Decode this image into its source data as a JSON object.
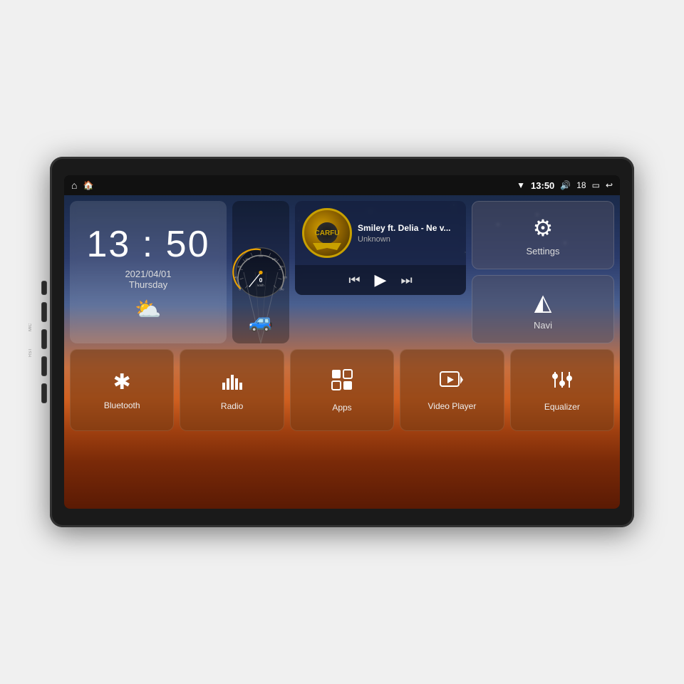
{
  "device": {
    "mic_label": "MIC",
    "rst_label": "RST"
  },
  "status_bar": {
    "time": "13:50",
    "volume": "18",
    "wifi_icon": "wifi",
    "battery_icon": "battery",
    "back_icon": "back"
  },
  "clock": {
    "time": "13 : 50",
    "date": "2021/04/01",
    "day": "Thursday",
    "weather_icon": "⛅"
  },
  "music": {
    "album_text": "CARFU",
    "title": "Smiley ft. Delia - Ne v...",
    "artist": "Unknown",
    "prev_icon": "⏮",
    "play_icon": "▶",
    "next_icon": "⏭"
  },
  "settings_btn": {
    "label": "Settings"
  },
  "navi_btn": {
    "label": "Navi"
  },
  "quick_buttons": [
    {
      "id": "bluetooth",
      "label": "Bluetooth"
    },
    {
      "id": "radio",
      "label": "Radio"
    },
    {
      "id": "apps",
      "label": "Apps"
    },
    {
      "id": "video-player",
      "label": "Video Player"
    },
    {
      "id": "equalizer",
      "label": "Equalizer"
    }
  ],
  "speed": {
    "value": "0",
    "unit": "km/h"
  }
}
